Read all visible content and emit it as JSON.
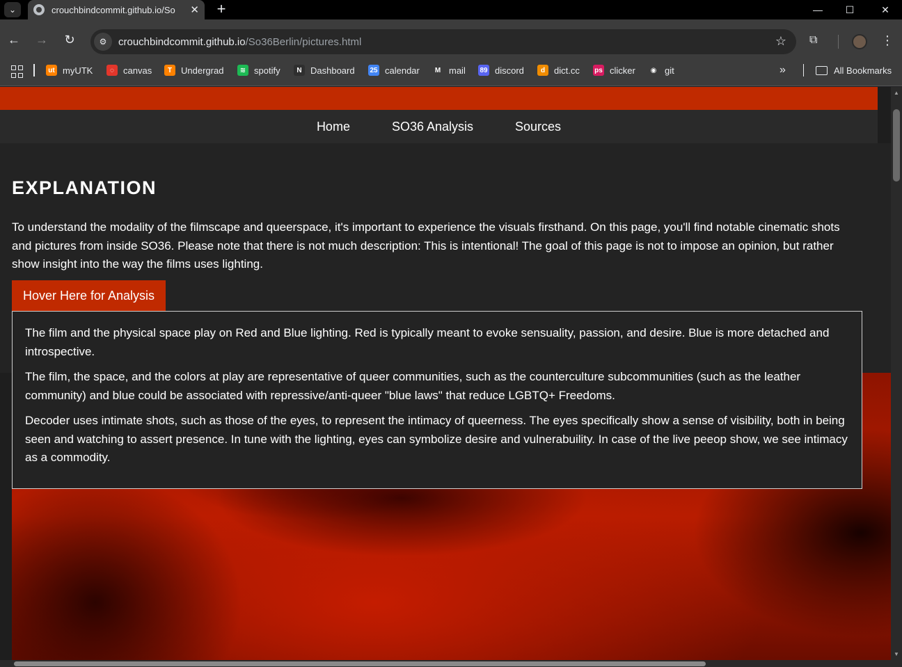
{
  "browser": {
    "tab_title": "crouchbindcommit.github.io/So",
    "tab_close": "✕",
    "new_tab": "+",
    "url_host": "crouchbindcommit.github.io",
    "url_path": "/So36Berlin/pictures.html",
    "bookmarks": [
      {
        "label": "myUTK",
        "icon": "utk-icon",
        "color": "#ff8200",
        "glyph": "ut"
      },
      {
        "label": "canvas",
        "icon": "canvas-icon",
        "color": "#e3362b",
        "glyph": "◌"
      },
      {
        "label": "Undergrad",
        "icon": "undergrad-icon",
        "color": "#ff8200",
        "glyph": "T"
      },
      {
        "label": "spotify",
        "icon": "spotify-icon",
        "color": "#1db954",
        "glyph": "≋"
      },
      {
        "label": "Dashboard",
        "icon": "notion-icon",
        "color": "#2f2f2f",
        "glyph": "N"
      },
      {
        "label": "calendar",
        "icon": "calendar-icon",
        "color": "#4285f4",
        "glyph": "25"
      },
      {
        "label": "mail",
        "icon": "gmail-icon",
        "color": "#3c3c3c",
        "glyph": "M"
      },
      {
        "label": "discord",
        "icon": "discord-icon",
        "color": "#5865f2",
        "glyph": "89"
      },
      {
        "label": "dict.cc",
        "icon": "dictcc-icon",
        "color": "#f08c00",
        "glyph": "d"
      },
      {
        "label": "clicker",
        "icon": "clicker-icon",
        "color": "#d81b60",
        "glyph": "ps"
      },
      {
        "label": "git",
        "icon": "github-icon",
        "color": "#3c3c3c",
        "glyph": "◉"
      }
    ],
    "all_bookmarks": "All Bookmarks"
  },
  "site": {
    "nav": [
      "Home",
      "SO36 Analysis",
      "Sources"
    ],
    "heading": "EXPLANATION",
    "intro": "To understand the modality of the filmscape and queerspace, it's important to experience the visuals firsthand. On this page, you'll find notable cinematic shots and pictures from inside SO36. Please note that there is not much description: This is intentional! The goal of this page is not to impose an opinion, but rather show insight into the way the films uses lighting.",
    "hover_label": "Hover Here for Analysis",
    "analysis": [
      "The film and the physical space play on Red and Blue lighting. Red is typically meant to evoke sensuality, passion, and desire. Blue is more detached and introspective.",
      "The film, the space, and the colors at play are representative of queer communities, such as the counterculture subcommunities (such as the leather community) and blue could be associated with repressive/anti-queer \"blue laws\" that reduce LGBTQ+ Freedoms.",
      "Decoder uses intimate shots, such as those of the eyes, to represent the intimacy of queerness. The eyes specifically show a sense of visibility, both in being seen and watching to assert presence. In tune with the lighting, eyes can symbolize desire and vulnerabuility. In case of the live peeop show, we see intimacy as a commodity."
    ]
  },
  "colors": {
    "accent": "#c02a00",
    "page_bg": "#232323"
  }
}
